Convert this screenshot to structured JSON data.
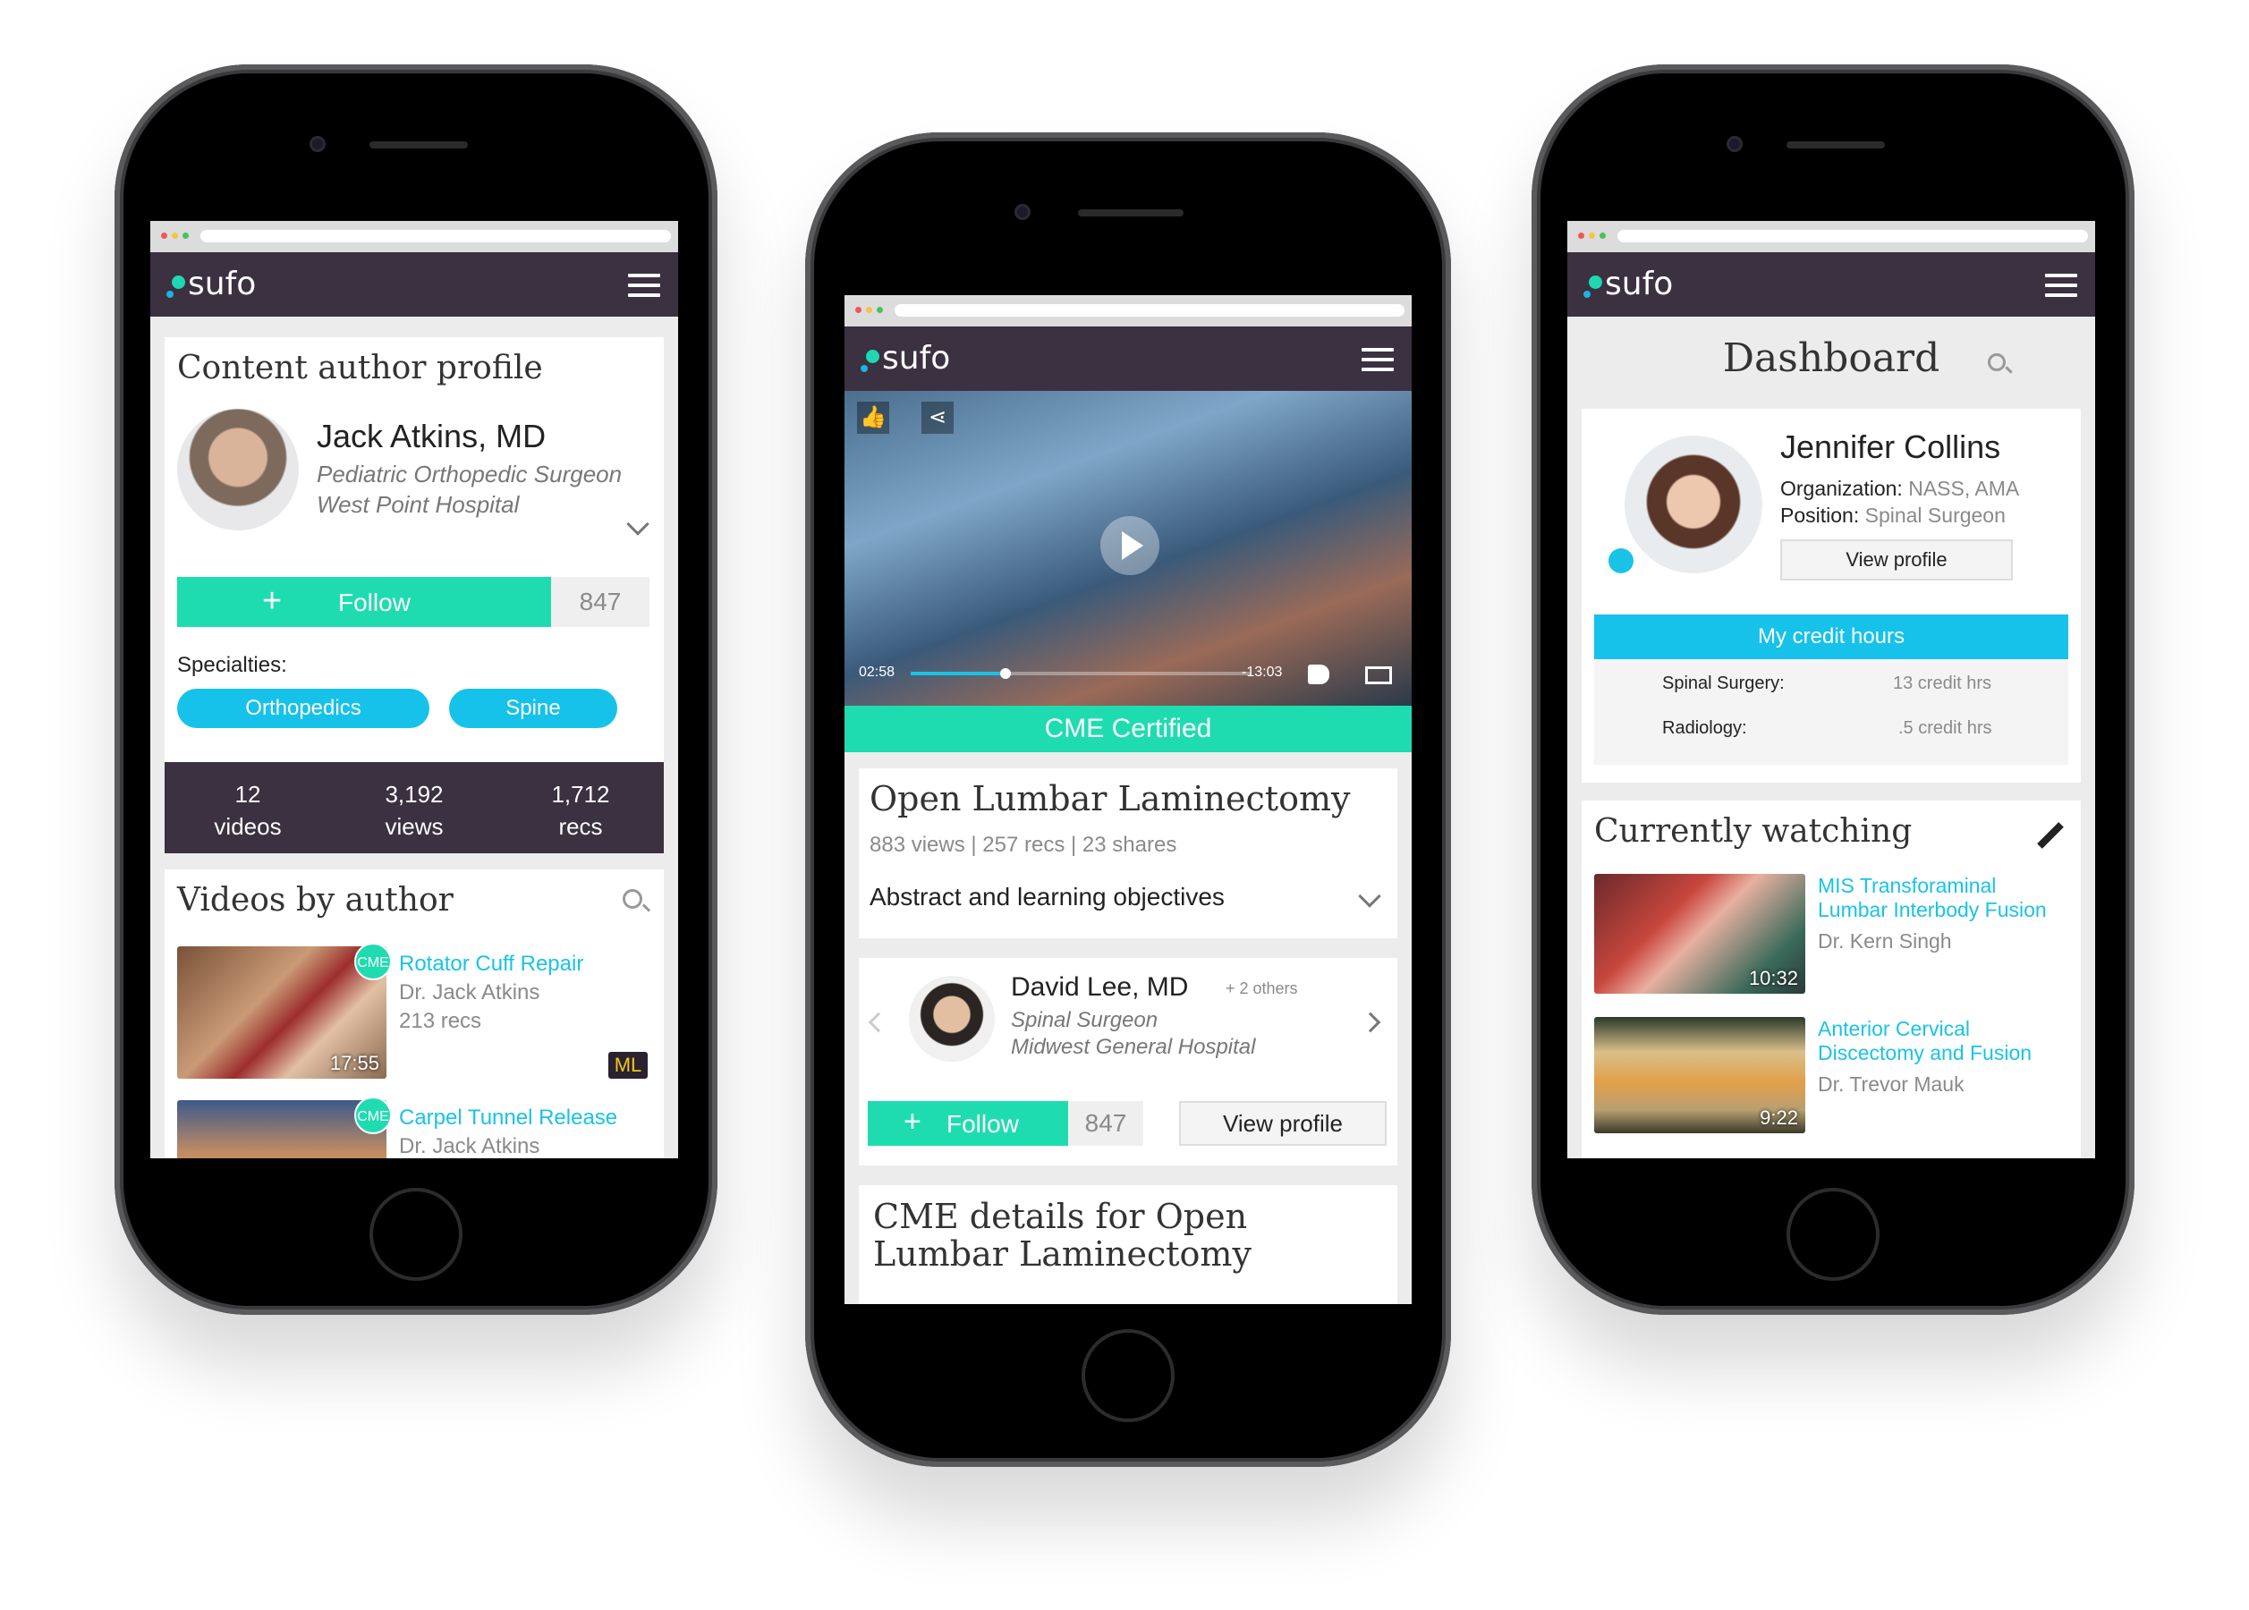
{
  "brand": {
    "name": "sufo",
    "accent": "#19c3e6",
    "follow_color": "#1fdcb0",
    "appbar_color": "#3b3141"
  },
  "left": {
    "title": "Content author profile",
    "author": {
      "name": "Jack Atkins, MD",
      "specialty": "Pediatric Orthopedic Surgeon",
      "hospital": "West Point Hospital"
    },
    "follow_label": "Follow",
    "follow_count": "847",
    "specialties_label": "Specialties:",
    "specialties": [
      "Orthopedics",
      "Spine"
    ],
    "stats": [
      {
        "value": "12",
        "label": "videos"
      },
      {
        "value": "3,192",
        "label": "views"
      },
      {
        "value": "1,712",
        "label": "recs"
      }
    ],
    "videos_title": "Videos by author",
    "videos": [
      {
        "title": "Rotator Cuff Repair",
        "author": "Dr. Jack Atkins",
        "recs": "213 recs",
        "duration": "17:55",
        "badge": "CME",
        "tag": "ML"
      },
      {
        "title": "Carpel Tunnel Release",
        "author": "Dr. Jack Atkins",
        "badge": "CME"
      }
    ]
  },
  "center": {
    "video": {
      "elapsed": "02:58",
      "remaining": "-13:03",
      "progress": 0.28
    },
    "cme_banner": "CME Certified",
    "title": "Open Lumbar Laminectomy",
    "meta": "883 views | 257 recs | 23 shares",
    "abstract_label": "Abstract and learning objectives",
    "author": {
      "name": "David Lee, MD",
      "others": "+ 2 others",
      "specialty": "Spinal Surgeon",
      "hospital": "Midwest General Hospital"
    },
    "follow_label": "Follow",
    "follow_count": "847",
    "view_profile": "View profile",
    "cme_details_title": "CME details for Open Lumbar Laminectomy"
  },
  "right": {
    "title": "Dashboard",
    "user": {
      "name": "Jennifer Collins",
      "org_label": "Organization:",
      "org": "NASS, AMA",
      "pos_label": "Position:",
      "pos": "Spinal Surgeon"
    },
    "view_profile": "View profile",
    "credit_header": "My credit hours",
    "credits": [
      {
        "label": "Spinal Surgery:",
        "value": "13 credit hrs"
      },
      {
        "label": "Radiology:",
        "value": ".5 credit hrs"
      }
    ],
    "watching_title": "Currently watching",
    "watching": [
      {
        "title_line1": "MIS Transforaminal",
        "title_line2": "Lumbar Interbody Fusion",
        "author": "Dr. Kern Singh",
        "duration": "10:32"
      },
      {
        "title_line1": "Anterior Cervical",
        "title_line2": "Discectomy and Fusion",
        "author": "Dr. Trevor Mauk",
        "duration": "9:22"
      }
    ]
  }
}
